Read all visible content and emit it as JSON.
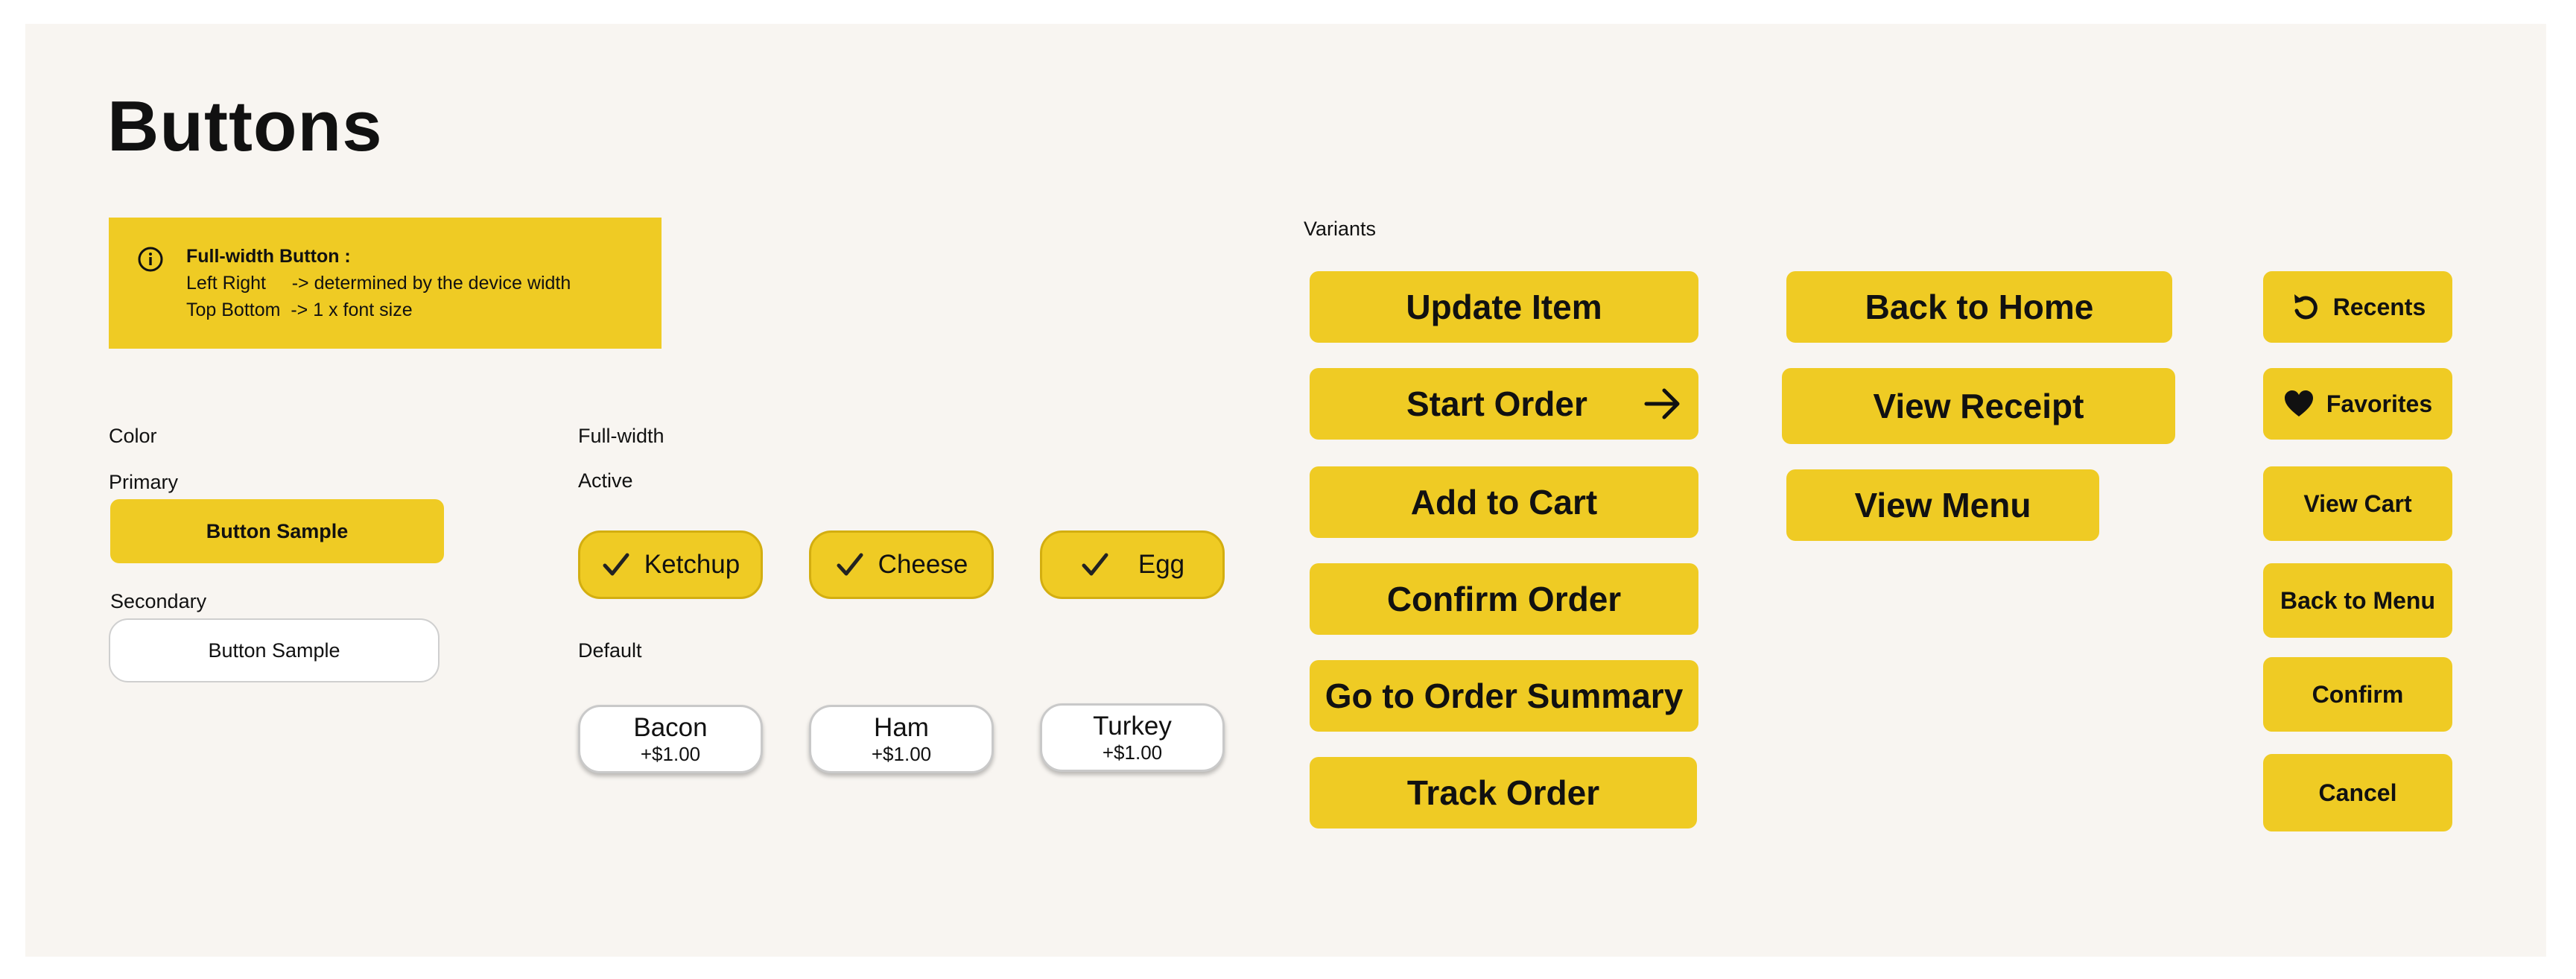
{
  "page": {
    "title": "Buttons"
  },
  "info": {
    "heading": "Full-width Button :",
    "line1": "Left Right     -> determined by the device width",
    "line2": "Top Bottom  -> 1 x font size"
  },
  "color_section": {
    "label": "Color",
    "primary_label": "Primary",
    "primary_button": "Button Sample",
    "secondary_label": "Secondary",
    "secondary_button": "Button Sample"
  },
  "fullwidth_section": {
    "label": "Full-width",
    "active_label": "Active",
    "active": [
      {
        "label": "Ketchup"
      },
      {
        "label": "Cheese"
      },
      {
        "label": "Egg"
      }
    ],
    "default_label": "Default",
    "default": [
      {
        "label": "Bacon",
        "price": "+$1.00"
      },
      {
        "label": "Ham",
        "price": "+$1.00"
      },
      {
        "label": "Turkey",
        "price": "+$1.00"
      }
    ]
  },
  "variants": {
    "label": "Variants",
    "column1": [
      "Update Item",
      "Start Order",
      "Add to Cart",
      "Confirm Order",
      "Go to Order Summary",
      "Track Order"
    ],
    "column2": [
      "Back to Home",
      "View Receipt",
      "View Menu"
    ],
    "column3": [
      "Recents",
      "Favorites",
      "View Cart",
      "Back to Menu",
      "Confirm",
      "Cancel"
    ]
  },
  "icons": {
    "info": "info-icon",
    "check": "check-icon",
    "arrow": "arrow-right-icon",
    "recents": "undo-icon",
    "favorites": "heart-icon"
  },
  "colors": {
    "accent": "#efcb24",
    "background": "#f8f5f1"
  }
}
